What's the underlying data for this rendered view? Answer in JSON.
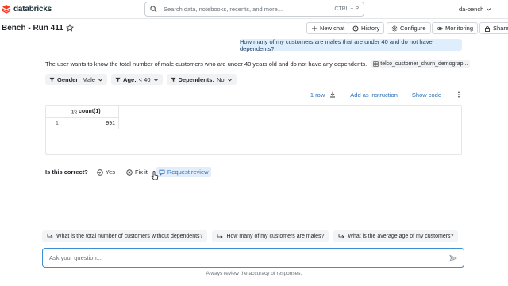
{
  "app": {
    "brand": "databricks",
    "brand_color": "#ff3621",
    "accent": "#2d6fb5"
  },
  "search": {
    "placeholder": "Search data, notebooks, recents, and more...",
    "shortcut": "CTRL + P"
  },
  "workspace": {
    "name": "da-bench"
  },
  "header": {
    "title": "Bench - Run 411",
    "buttons": {
      "new_chat": "New chat",
      "history": "History",
      "configure": "Configure",
      "monitoring": "Monitoring",
      "share": "Share"
    }
  },
  "conversation": {
    "question": "How many of my customers are males that are under 40 and do not have dependents?",
    "answer_text": "The user wants to know the total number of male customers who are under 40 years old and do not have any dependents.",
    "table_ref": "telco_customer_churn_demograp...",
    "filters": [
      {
        "key": "Gender:",
        "value": "Male"
      },
      {
        "key": "Age:",
        "value": "< 40"
      },
      {
        "key": "Dependents:",
        "value": "No"
      }
    ]
  },
  "result": {
    "row_count": "1 row",
    "add_instruction": "Add as instruction",
    "show_code": "Show code",
    "column": "count(1)",
    "rows": [
      {
        "index": "1",
        "value": "991"
      }
    ]
  },
  "feedback": {
    "question": "Is this correct?",
    "yes": "Yes",
    "fix": "Fix it",
    "review": "Request review"
  },
  "suggestions": [
    "What is the total number of customers without dependents?",
    "How many of my customers are males?",
    "What is the average age of my customers?"
  ],
  "input": {
    "placeholder": "Ask your question..."
  },
  "disclaimer": "Always review the accuracy of responses."
}
